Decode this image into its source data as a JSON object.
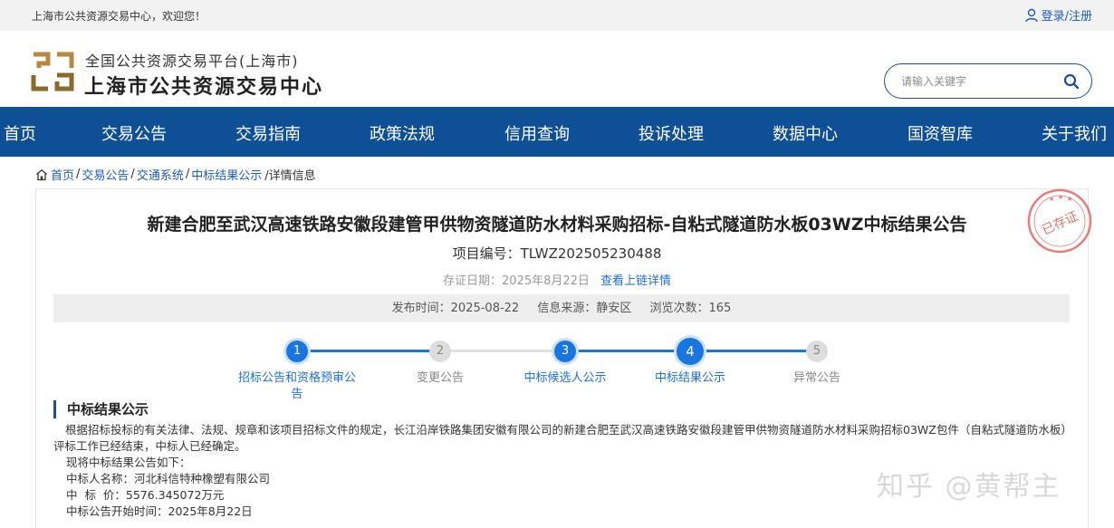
{
  "topbar": {
    "welcome": "上海市公共资源交易中心，欢迎您！",
    "login": "登录/注册"
  },
  "brand": {
    "subtitle": "全国公共资源交易平台(上海市)",
    "title": "上海市公共资源交易中心"
  },
  "search": {
    "placeholder": "请输入关键字"
  },
  "nav": [
    "首页",
    "交易公告",
    "交易指南",
    "政策法规",
    "信用查询",
    "投诉处理",
    "数据中心",
    "国资智库",
    "关于我们"
  ],
  "breadcrumb": {
    "items": [
      "首页",
      "交易公告",
      "交通系统",
      "中标结果公示"
    ],
    "current": "/详情信息"
  },
  "article": {
    "title": "新建合肥至武汉高速铁路安徽段建管甲供物资隧道防水材料采购招标-自粘式隧道防水板03WZ中标结果公告",
    "project_no": "项目编号：TLWZ202505230488",
    "deposit_date": "存证日期：2025年8月22日",
    "chain_link": "查看上链详情",
    "stamp_text": "已存证",
    "publish_time": "发布时间：2025-08-22",
    "source": "信息来源：静安区",
    "views": "浏览次数：165"
  },
  "steps": [
    {
      "num": "1",
      "label": "招标公告和资格预审公",
      "label2": "告",
      "active": true
    },
    {
      "num": "2",
      "label": "变更公告",
      "active": false
    },
    {
      "num": "3",
      "label": "中标候选人公示",
      "active": true
    },
    {
      "num": "4",
      "label": "中标结果公示",
      "active": true,
      "current": true
    },
    {
      "num": "5",
      "label": "异常公告",
      "active": false
    }
  ],
  "section": {
    "title": "中标结果公示",
    "paragraph": "根据招标投标的有关法律、法规、规章和该项目招标文件的规定，长江沿岸铁路集团安徽有限公司的新建合肥至武汉高速铁路安徽段建管甲供物资隧道防水材料采购招标03WZ包件（自粘式隧道防水板）评标工作已经结束，中标人已经确定。",
    "lines": [
      "现将中标结果公告如下：",
      "中标人名称：河北科信特种橡塑有限公司",
      "中  标  价：5576.345072万元",
      "中标公告开始时间：2025年8月22日"
    ]
  },
  "watermark": "知乎 @黄帮主",
  "colors": {
    "nav_bg": "#0f4f96",
    "accent": "#1976e0",
    "link": "#1e6fd9",
    "stamp": "#d9534f"
  }
}
